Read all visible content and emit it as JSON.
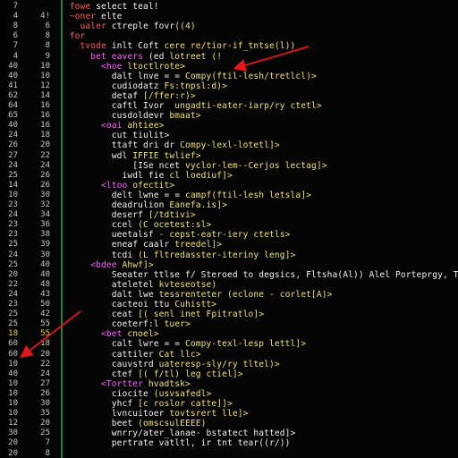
{
  "colors": {
    "background": "#050505",
    "line_number": "#c9c9c9",
    "keyword": "#ff5b5b",
    "tag": "#ff5fff",
    "string": "#f0e070",
    "plain": "#f0f0f0",
    "gutter_separator": "#2a7d3a",
    "annotation_arrow": "#e01818"
  },
  "lines": [
    {
      "a": "7",
      "b": "",
      "segments": [
        {
          "c": "k",
          "t": "  fowe "
        },
        {
          "c": "w",
          "t": "select teal!"
        }
      ]
    },
    {
      "a": "4",
      "b": "4!",
      "segments": [
        {
          "c": "k",
          "t": "  ~oner "
        },
        {
          "c": "w",
          "t": "elte"
        }
      ]
    },
    {
      "a": "8",
      "b": "6",
      "segments": [
        {
          "c": "k",
          "t": "    ualer "
        },
        {
          "c": "w",
          "t": "ctreple fovr"
        },
        {
          "c": "s",
          "t": "((4)"
        }
      ]
    },
    {
      "a": "6",
      "b": "8",
      "segments": [
        {
          "c": "k",
          "t": "  for"
        }
      ]
    },
    {
      "a": "7",
      "b": "8",
      "segments": [
        {
          "c": "k",
          "t": "    tvode "
        },
        {
          "c": "w",
          "t": "inlt Coft "
        },
        {
          "c": "s",
          "t": "cere re/tior-if_tntse(l))"
        }
      ]
    },
    {
      "a": "4",
      "b": "9",
      "segments": [
        {
          "c": "t",
          "t": "      bet eavers "
        },
        {
          "c": "w",
          "t": "(ed "
        },
        {
          "c": "s",
          "t": "lotreet (!"
        }
      ]
    },
    {
      "a": "40",
      "b": "10",
      "segments": [
        {
          "c": "t",
          "t": "        <hoe "
        },
        {
          "c": "s",
          "t": "ltoctlrote>"
        }
      ]
    },
    {
      "a": "40",
      "b": "10",
      "segments": [
        {
          "c": "w",
          "t": "          dalt lnve = = "
        },
        {
          "c": "s",
          "t": "Compy(ftil-lesh/tretlcl)>"
        }
      ]
    },
    {
      "a": "41",
      "b": "12",
      "segments": [
        {
          "c": "w",
          "t": "          cudiodatz "
        },
        {
          "c": "s",
          "t": "Fs:tnpsl:d)>"
        }
      ]
    },
    {
      "a": "62",
      "b": "14",
      "segments": [
        {
          "c": "w",
          "t": "          detaf "
        },
        {
          "c": "s",
          "t": "[/ffer:r)>"
        }
      ]
    },
    {
      "a": "64",
      "b": "16",
      "segments": [
        {
          "c": "w",
          "t": "          caftl "
        },
        {
          "c": "w",
          "t": "Ivor  "
        },
        {
          "c": "s",
          "t": "ungadti-eater-iarp/ry ctetl>"
        }
      ]
    },
    {
      "a": "65",
      "b": "16",
      "segments": [
        {
          "c": "w",
          "t": "          cusdoldevr "
        },
        {
          "c": "s",
          "t": "bmaat>"
        }
      ]
    },
    {
      "a": "40",
      "b": "16",
      "segments": [
        {
          "c": "t",
          "t": "        <oai "
        },
        {
          "c": "s",
          "t": "ahtiee>"
        }
      ]
    },
    {
      "a": "24",
      "b": "18",
      "segments": [
        {
          "c": "w",
          "t": "          cut tiulit>"
        }
      ]
    },
    {
      "a": "26",
      "b": "20",
      "segments": [
        {
          "c": "w",
          "t": "          ttaft dri dr "
        },
        {
          "c": "s",
          "t": "Compy-lexl-lotetl]>"
        }
      ]
    },
    {
      "a": "27",
      "b": "22",
      "segments": [
        {
          "c": "w",
          "t": "          wdl "
        },
        {
          "c": "s",
          "t": "IFFIE twlief>"
        }
      ]
    },
    {
      "a": "24",
      "b": "24",
      "segments": [
        {
          "c": "w",
          "t": "              [ISe ncet "
        },
        {
          "c": "s",
          "t": "vyclor-lem--Cerjos lectag]>"
        }
      ]
    },
    {
      "a": "25",
      "b": "26",
      "segments": [
        {
          "c": "w",
          "t": "            iwdl fie "
        },
        {
          "c": "s",
          "t": "cl loediuf]>"
        }
      ]
    },
    {
      "a": "14",
      "b": "26",
      "segments": [
        {
          "c": "t",
          "t": "        <ltoo "
        },
        {
          "c": "s",
          "t": "ofectit>"
        }
      ]
    },
    {
      "a": "10",
      "b": "30",
      "segments": [
        {
          "c": "w",
          "t": "          delt lwne = = "
        },
        {
          "c": "s",
          "t": "campf(ftil-lesh letsla]>"
        }
      ]
    },
    {
      "a": "23",
      "b": "32",
      "segments": [
        {
          "c": "w",
          "t": "          deadrulion "
        },
        {
          "c": "s",
          "t": "Eanefa.is]>"
        }
      ]
    },
    {
      "a": "24",
      "b": "34",
      "segments": [
        {
          "c": "w",
          "t": "          deserf "
        },
        {
          "c": "s",
          "t": "[/tdtivi>"
        }
      ]
    },
    {
      "a": "23",
      "b": "36",
      "segments": [
        {
          "c": "w",
          "t": "          ccel "
        },
        {
          "c": "s",
          "t": "(C ocetest:sl>"
        }
      ]
    },
    {
      "a": "23",
      "b": "38",
      "segments": [
        {
          "c": "w",
          "t": "          ueetalsf "
        },
        {
          "c": "s",
          "t": "- cepst-eatr-iery ctetls>"
        }
      ]
    },
    {
      "a": "25",
      "b": "39",
      "segments": [
        {
          "c": "w",
          "t": "          eneaf "
        },
        {
          "c": "w",
          "t": "caalr "
        },
        {
          "c": "s",
          "t": "treedel]>"
        }
      ]
    },
    {
      "a": "24",
      "b": "30",
      "segments": [
        {
          "c": "w",
          "t": "          tcdi "
        },
        {
          "c": "s",
          "t": "(L fltredasster-iteriny leng]>"
        }
      ]
    },
    {
      "a": "25",
      "b": "40",
      "segments": [
        {
          "c": "t",
          "t": "      <bdee "
        },
        {
          "c": "s",
          "t": "Ahwf]>"
        }
      ]
    },
    {
      "a": "20",
      "b": "40",
      "segments": [
        {
          "c": "w",
          "t": "          Seeater ttlse f/ Steroed to degsics, Fltsha(Al)) Alel Porteprgy, Tpg,alne"
        }
      ]
    },
    {
      "a": "22",
      "b": "48",
      "segments": [
        {
          "c": "w",
          "t": "          ateletel "
        },
        {
          "c": "s",
          "t": "kvteseotse)"
        }
      ]
    },
    {
      "a": "24",
      "b": "43",
      "segments": [
        {
          "c": "w",
          "t": "          dalt "
        },
        {
          "c": "w",
          "t": "lwe "
        },
        {
          "c": "s",
          "t": "tessrenteter (eclone - corlet[A)>"
        }
      ]
    },
    {
      "a": "23",
      "b": "50",
      "segments": [
        {
          "c": "w",
          "t": "          cacteoi "
        },
        {
          "c": "w",
          "t": "ttu "
        },
        {
          "c": "s",
          "t": "Cuhistt>"
        }
      ]
    },
    {
      "a": "25",
      "b": "42",
      "segments": [
        {
          "c": "w",
          "t": "          ceat "
        },
        {
          "c": "s",
          "t": "[( senl inet Fpitratlo]>"
        }
      ]
    },
    {
      "a": "25",
      "b": "55",
      "segments": [
        {
          "c": "w",
          "t": "          coeterf:l "
        },
        {
          "c": "s",
          "t": "tuer>"
        }
      ]
    },
    {
      "a": "18",
      "b": "55",
      "segments": [
        {
          "c": "t",
          "t": "        <bet "
        },
        {
          "c": "s",
          "t": "cnoel>"
        }
      ]
    },
    {
      "a": "60",
      "b": "18",
      "segments": [
        {
          "c": "w",
          "t": "          calt lwre = = "
        },
        {
          "c": "s",
          "t": "Compy-texl-lesp lettl]>"
        }
      ]
    },
    {
      "a": "60",
      "b": "20",
      "segments": [
        {
          "c": "w",
          "t": "          cattiler "
        },
        {
          "c": "s",
          "t": "Cat llc>"
        }
      ]
    },
    {
      "a": "10",
      "b": "22",
      "segments": [
        {
          "c": "w",
          "t": "          cauvstrd "
        },
        {
          "c": "s",
          "t": "uateresp-sly/ry tltel)>"
        }
      ]
    },
    {
      "a": "40",
      "b": "24",
      "segments": [
        {
          "c": "w",
          "t": "          ctef "
        },
        {
          "c": "s",
          "t": "[( f/tl) leg ctiel]>"
        }
      ]
    },
    {
      "a": "10",
      "b": "27",
      "segments": [
        {
          "c": "t",
          "t": "        <Tortter "
        },
        {
          "c": "s",
          "t": "hvadtsk>"
        }
      ]
    },
    {
      "a": "10",
      "b": "26",
      "segments": [
        {
          "c": "w",
          "t": "          ciocite "
        },
        {
          "c": "s",
          "t": "(usvsafedl>"
        }
      ]
    },
    {
      "a": "10",
      "b": "30",
      "segments": [
        {
          "c": "w",
          "t": "          yhcf "
        },
        {
          "c": "s",
          "t": "[c roslor catte]]>"
        }
      ]
    },
    {
      "a": "10",
      "b": "35",
      "segments": [
        {
          "c": "w",
          "t": "          lvncuitoer "
        },
        {
          "c": "s",
          "t": "tovtsrert lle]>"
        }
      ]
    },
    {
      "a": "12",
      "b": "20",
      "segments": [
        {
          "c": "w",
          "t": "          beet "
        },
        {
          "c": "s",
          "t": "(omscsulEEEE)"
        }
      ]
    },
    {
      "a": "30",
      "b": "25",
      "segments": [
        {
          "c": "w",
          "t": "          wnrry/ater_lanae- "
        },
        {
          "c": "w",
          "t": "bstatect hatted]>"
        }
      ]
    },
    {
      "a": "20",
      "b": "7",
      "segments": [
        {
          "c": "w",
          "t": "          pertrate vatltl, ir tnt tear((r/))"
        }
      ]
    },
    {
      "a": "20",
      "b": "8",
      "segments": [
        {
          "c": "k",
          "t": "  "
        }
      ]
    }
  ]
}
